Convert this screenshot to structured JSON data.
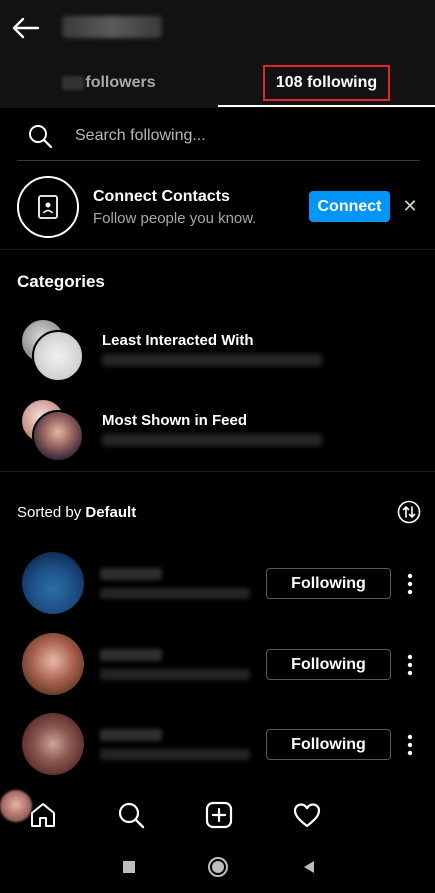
{
  "tabs": {
    "followers_label": "followers",
    "following_label": "108 following"
  },
  "search": {
    "placeholder": "Search following..."
  },
  "connect": {
    "title": "Connect Contacts",
    "subtitle": "Follow people you know.",
    "button_label": "Connect",
    "dismiss_glyph": "✕"
  },
  "categories": {
    "title": "Categories",
    "items": [
      {
        "label": "Least Interacted With"
      },
      {
        "label": "Most Shown in Feed"
      }
    ]
  },
  "sort": {
    "prefix": "Sorted by ",
    "value": "Default"
  },
  "users": [
    {
      "button_label": "Following"
    },
    {
      "button_label": "Following"
    },
    {
      "button_label": "Following"
    }
  ],
  "colors": {
    "accent": "#0095f6",
    "highlight": "#e0262b",
    "background": "#000000",
    "header": "#121212"
  },
  "icons": {
    "back": "back-arrow-icon",
    "search": "search-icon",
    "contact": "contact-card-icon",
    "sort": "sort-toggle-icon",
    "more": "more-vertical-icon",
    "nav": [
      "home-icon",
      "search-icon",
      "add-post-icon",
      "heart-icon",
      "profile-avatar"
    ],
    "system": [
      "recents-square-icon",
      "home-circle-icon",
      "back-triangle-icon"
    ]
  }
}
